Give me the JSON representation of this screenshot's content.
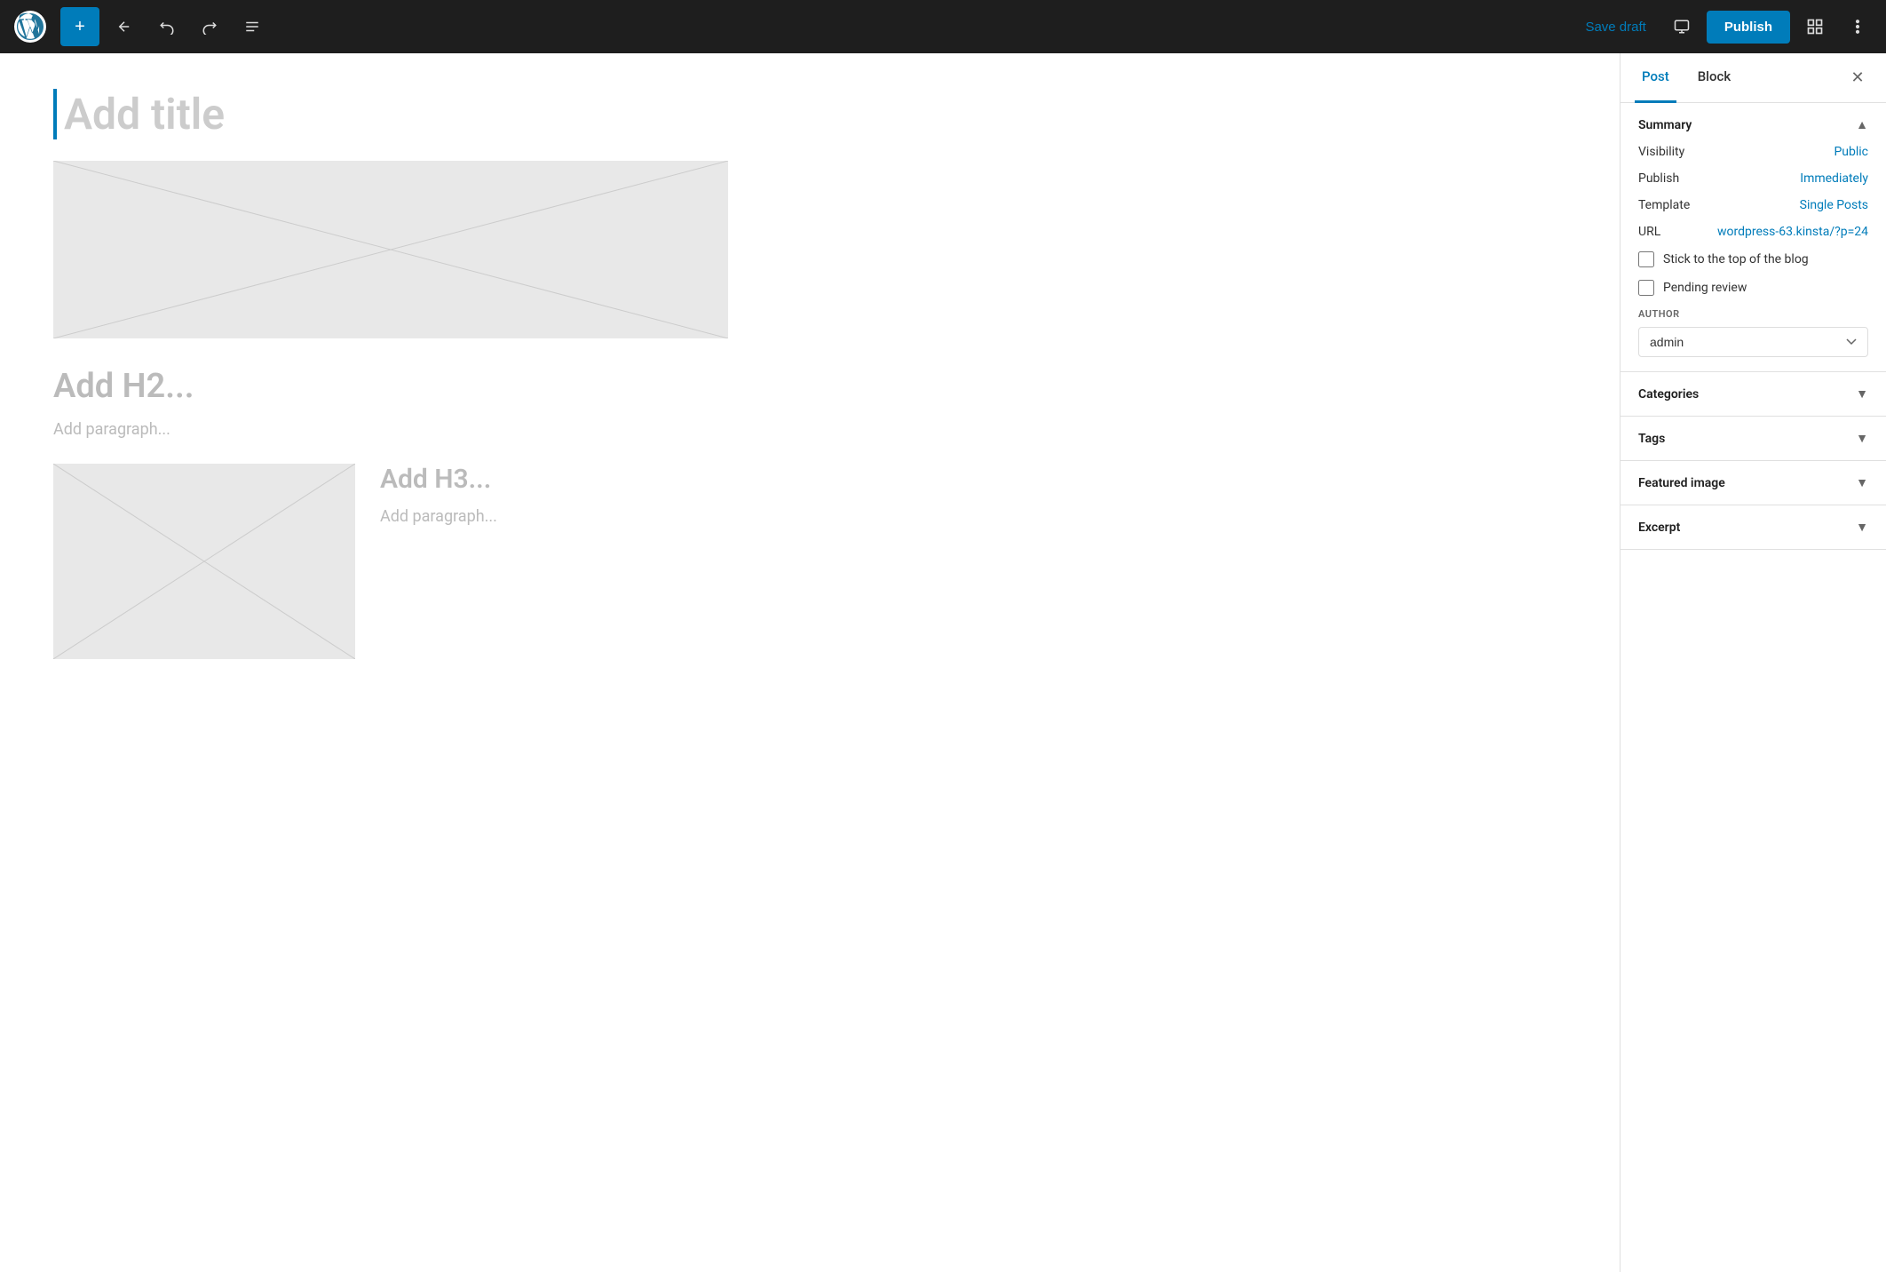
{
  "topbar": {
    "add_label": "+",
    "save_draft_label": "Save draft",
    "publish_label": "Publish"
  },
  "editor": {
    "title_placeholder": "Add title",
    "h2_placeholder": "Add H2...",
    "paragraph_placeholder": "Add paragraph...",
    "h3_placeholder": "Add H3...",
    "paragraph2_placeholder": "Add paragraph..."
  },
  "sidebar": {
    "tab_post": "Post",
    "tab_block": "Block",
    "summary_title": "Summary",
    "visibility_label": "Visibility",
    "visibility_value": "Public",
    "publish_label": "Publish",
    "publish_value": "Immediately",
    "template_label": "Template",
    "template_value": "Single Posts",
    "url_label": "URL",
    "url_value": "wordpress-63.kinsta/?p=24",
    "sticky_label": "Stick to the top of the blog",
    "pending_label": "Pending review",
    "author_label": "AUTHOR",
    "author_value": "admin",
    "categories_label": "Categories",
    "tags_label": "Tags",
    "featured_image_label": "Featured image",
    "excerpt_label": "Excerpt"
  }
}
